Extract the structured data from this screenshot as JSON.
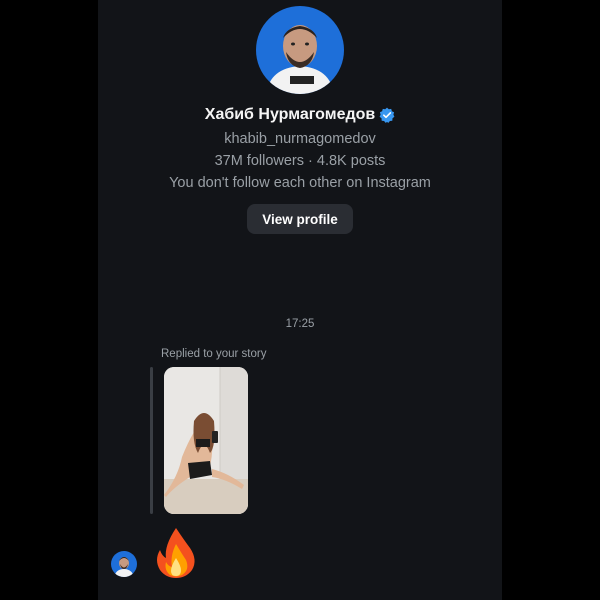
{
  "profile": {
    "display_name": "Хабиб Нурмагомедов",
    "username": "khabib_nurmagomedov",
    "stats": "37M followers · 4.8K posts",
    "follow_status": "You don't follow each other on Instagram",
    "view_profile_label": "View profile",
    "verified_icon": "verified-badge-icon",
    "verified_color": "#3897f0"
  },
  "thread": {
    "timestamp": "17:25",
    "reply_context": "Replied to your story",
    "reaction_icon": "fire-emoji-icon"
  },
  "colors": {
    "background": "#121418",
    "outer": "#000000",
    "secondary_text": "#9aa0a6",
    "button_bg": "#2a2d33",
    "avatar_bg": "#1e6fd9"
  }
}
